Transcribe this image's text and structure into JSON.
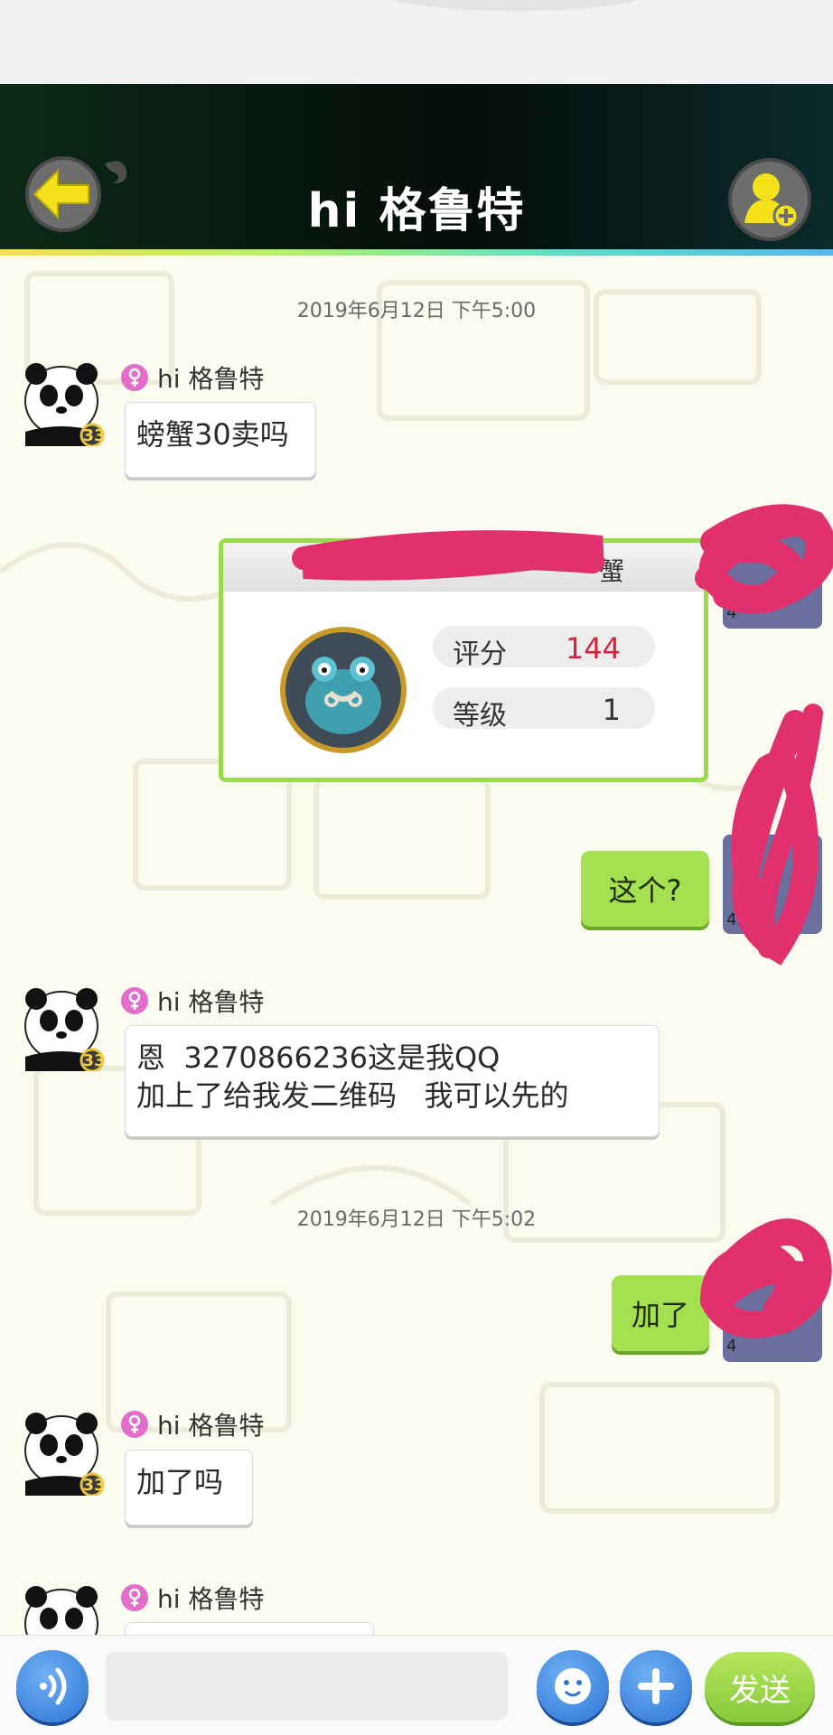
{
  "header": {
    "title": "hi 格鲁特"
  },
  "timestamps": [
    "2019年6月12日 下午5:00",
    "2019年6月12日 下午5:02"
  ],
  "contact": {
    "name": "hi 格鲁特",
    "level": "33"
  },
  "messages": [
    {
      "side": "left",
      "text": "螃蟹30卖吗"
    },
    {
      "side": "right",
      "type": "card"
    },
    {
      "side": "right",
      "text": "这个?"
    },
    {
      "side": "left",
      "text": "恩  3270866236这是我QQ\n加上了给我发二维码   我可以先的"
    },
    {
      "side": "right",
      "text": "加了"
    },
    {
      "side": "left",
      "text": "加了吗"
    },
    {
      "side": "left",
      "text": ""
    }
  ],
  "card": {
    "title_visible": "蟹",
    "rating_label": "评分",
    "rating_value": "144",
    "level_label": "等级",
    "level_value": "1"
  },
  "self_levels": [
    "4",
    "4",
    "42"
  ],
  "input": {
    "value": "",
    "send_label": "发送"
  },
  "colors": {
    "bubble_green": "#a4e050",
    "card_border": "#98dc4e",
    "rating_red": "#d6223e",
    "blue_button": "#2d74d4",
    "redaction_pink": "#e0306e"
  }
}
